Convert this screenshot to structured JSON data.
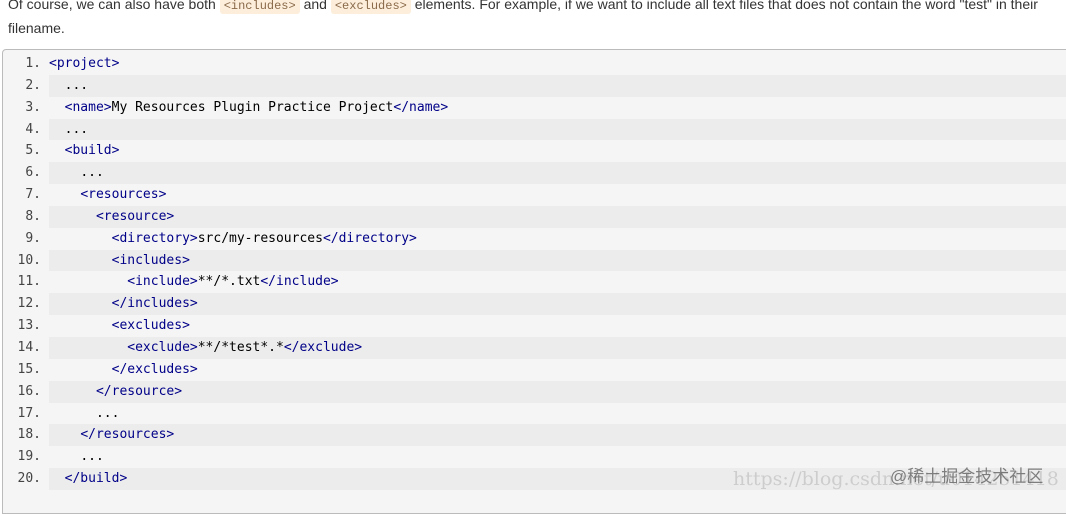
{
  "paragraph": {
    "before": "Of course, we can also have both ",
    "code1": "<includes>",
    "mid": " and ",
    "code2": "<excludes>",
    "after": " elements. For example, if we want to include all text files that does not contain the word \"test\" in their filename."
  },
  "code_lines": [
    {
      "n": "1.",
      "indent": "",
      "tag1": "<project>",
      "text": "",
      "tag2": ""
    },
    {
      "n": "2.",
      "indent": "  ",
      "tag1": "",
      "text": "...",
      "tag2": ""
    },
    {
      "n": "3.",
      "indent": "  ",
      "tag1": "<name>",
      "text": "My Resources Plugin Practice Project",
      "tag2": "</name>"
    },
    {
      "n": "4.",
      "indent": "  ",
      "tag1": "",
      "text": "...",
      "tag2": ""
    },
    {
      "n": "5.",
      "indent": "  ",
      "tag1": "<build>",
      "text": "",
      "tag2": ""
    },
    {
      "n": "6.",
      "indent": "    ",
      "tag1": "",
      "text": "...",
      "tag2": ""
    },
    {
      "n": "7.",
      "indent": "    ",
      "tag1": "<resources>",
      "text": "",
      "tag2": ""
    },
    {
      "n": "8.",
      "indent": "      ",
      "tag1": "<resource>",
      "text": "",
      "tag2": ""
    },
    {
      "n": "9.",
      "indent": "        ",
      "tag1": "<directory>",
      "text": "src/my-resources",
      "tag2": "</directory>"
    },
    {
      "n": "10.",
      "indent": "        ",
      "tag1": "<includes>",
      "text": "",
      "tag2": ""
    },
    {
      "n": "11.",
      "indent": "          ",
      "tag1": "<include>",
      "text": "**/*.txt",
      "tag2": "</include>"
    },
    {
      "n": "12.",
      "indent": "        ",
      "tag1": "</includes>",
      "text": "",
      "tag2": ""
    },
    {
      "n": "13.",
      "indent": "        ",
      "tag1": "<excludes>",
      "text": "",
      "tag2": ""
    },
    {
      "n": "14.",
      "indent": "          ",
      "tag1": "<exclude>",
      "text": "**/*test*.*",
      "tag2": "</exclude>"
    },
    {
      "n": "15.",
      "indent": "        ",
      "tag1": "</excludes>",
      "text": "",
      "tag2": ""
    },
    {
      "n": "16.",
      "indent": "      ",
      "tag1": "</resource>",
      "text": "",
      "tag2": ""
    },
    {
      "n": "17.",
      "indent": "      ",
      "tag1": "",
      "text": "...",
      "tag2": ""
    },
    {
      "n": "18.",
      "indent": "    ",
      "tag1": "</resources>",
      "text": "",
      "tag2": ""
    },
    {
      "n": "19.",
      "indent": "    ",
      "tag1": "",
      "text": "...",
      "tag2": ""
    },
    {
      "n": "20.",
      "indent": "  ",
      "tag1": "</build>",
      "text": "",
      "tag2": ""
    }
  ],
  "watermark": {
    "url": "https://blog.csdn.net/u014251418",
    "brand": "@稀土掘金技术社区"
  }
}
